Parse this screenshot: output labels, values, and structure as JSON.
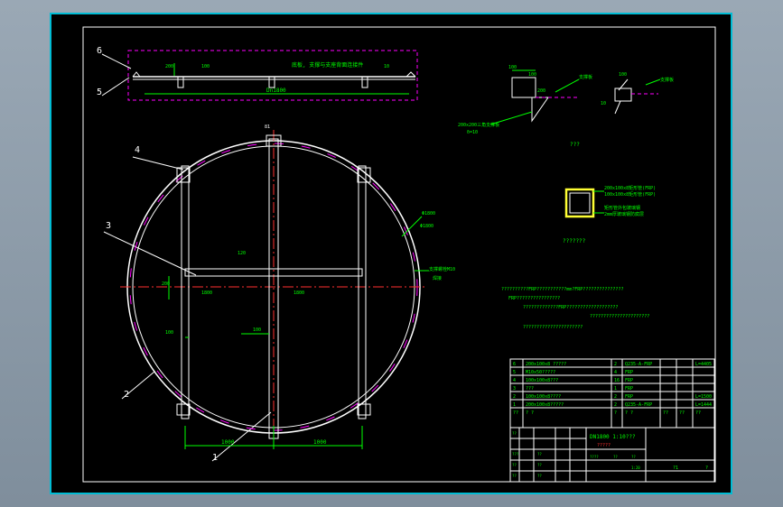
{
  "colors": {
    "background": "#000000",
    "border": "#ffffff",
    "frame": "#00bcd4",
    "outline": "#ffffff",
    "dimension": "#00ff00",
    "magenta": "#ff00ff",
    "centerline": "#ff3030",
    "yellow": "#ffff33"
  },
  "callouts": [
    "6",
    "5",
    "4",
    "3",
    "2",
    "1"
  ],
  "top_view": {
    "dim_top": "Dn1800",
    "left_dim": "200",
    "mid_dim": "100",
    "right_dim": "10",
    "note": "底板, 支撑与支座背面连接件"
  },
  "circle_view": {
    "top_label": "81",
    "right_label_1": "Φ1800",
    "right_label_2": "Φ1800",
    "right_note_1": "支撑螺栓M10",
    "right_note_2": "焊接",
    "left_dim": "200",
    "center_dim_1": "120",
    "center_dim_2": "1800",
    "center_dim_3": "1800",
    "small_dim_1": "100",
    "small_dim_2": "100",
    "bottom_dim_left": "1000",
    "bottom_dim_right": "1000"
  },
  "detail_a": {
    "label_1": "100",
    "label_2": "100",
    "label_3": "200",
    "note_1": "支撑板",
    "note_2": "200x200三角支撑板",
    "note_3": "δ=10",
    "title": "???"
  },
  "detail_b": {
    "label_1": "100",
    "note_1": "支撑板",
    "label_2": "10"
  },
  "section": {
    "note_1": "200x100x8矩形管(FRP)",
    "note_2": "100x100x8矩形管(FRP)",
    "note_3": "矩形管外包玻璃钢",
    "note_4": "2mm厚玻璃钢防腐层",
    "title": "???????"
  },
  "notes": [
    "??????????FRP???????????mm?FRP???????????????",
    "FRP????????????????",
    "?????????????FRP???????????????????",
    "??????????????????????",
    "??????????????????????"
  ],
  "bom": [
    {
      "no": "6",
      "spec": "200x100x8 ?????",
      "qty": "2",
      "mat": "Q235-A-FRP",
      "note": "L=4405"
    },
    {
      "no": "5",
      "spec": "M10x50?????",
      "qty": "4",
      "mat": "FRP",
      "note": ""
    },
    {
      "no": "4",
      "spec": "100x100x8???",
      "qty": "16",
      "mat": "FRP",
      "note": ""
    },
    {
      "no": "3",
      "spec": "???",
      "qty": "1",
      "mat": "FRP",
      "note": ""
    },
    {
      "no": "2",
      "spec": "100x100x8????",
      "qty": "2",
      "mat": "FRP",
      "note": "L=1500"
    },
    {
      "no": "1",
      "spec": "200x100x8?????",
      "qty": "2",
      "mat": "Q235-A-FRP",
      "note": "L=1444"
    }
  ],
  "bom_header": {
    "no": "??",
    "name": "?  ?",
    "qty": "?",
    "mat": "?  ?",
    "w1": "??",
    "w2": "??",
    "note": "??"
  },
  "title_block": {
    "title_1": "DN1800 1:10???",
    "title_2": "?????",
    "label_tl": "??",
    "label_row_1": "???",
    "label_row_2": "??",
    "label_row_3": "??",
    "label_row_4": "??",
    "label_row_5": "??",
    "label_row_6": "??",
    "scale": "1:20",
    "sheet": "?1",
    "sheets": "?",
    "ratio_label": "????",
    "weight_label": "??",
    "scale_label": "??"
  }
}
